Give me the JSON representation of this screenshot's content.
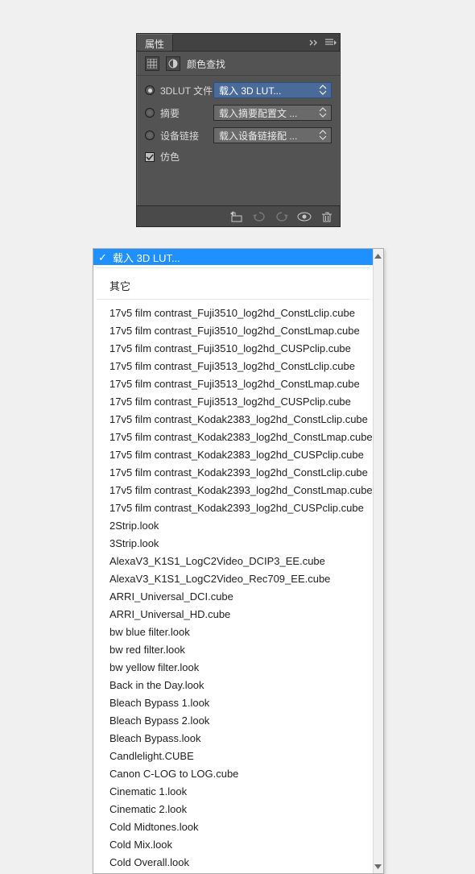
{
  "panel": {
    "tab_title": "属性",
    "header_title": "颜色查找",
    "rows": {
      "lut3d": {
        "label": "3DLUT 文件",
        "value": "载入 3D LUT..."
      },
      "abstract": {
        "label": "摘要",
        "value": "载入摘要配置文 ..."
      },
      "devicelink": {
        "label": "设备链接",
        "value": "载入设备链接配 ..."
      },
      "dither": {
        "label": "仿色"
      }
    }
  },
  "dropdown": {
    "selected": "载入 3D LUT...",
    "group_other": "其它",
    "items": [
      "17v5 film contrast_Fuji3510_log2hd_ConstLclip.cube",
      "17v5 film contrast_Fuji3510_log2hd_ConstLmap.cube",
      "17v5 film contrast_Fuji3510_log2hd_CUSPclip.cube",
      "17v5 film contrast_Fuji3513_log2hd_ConstLclip.cube",
      "17v5 film contrast_Fuji3513_log2hd_ConstLmap.cube",
      "17v5 film contrast_Fuji3513_log2hd_CUSPclip.cube",
      "17v5 film contrast_Kodak2383_log2hd_ConstLclip.cube",
      "17v5 film contrast_Kodak2383_log2hd_ConstLmap.cube",
      "17v5 film contrast_Kodak2383_log2hd_CUSPclip.cube",
      "17v5 film contrast_Kodak2393_log2hd_ConstLclip.cube",
      "17v5 film contrast_Kodak2393_log2hd_ConstLmap.cube",
      "17v5 film contrast_Kodak2393_log2hd_CUSPclip.cube",
      "2Strip.look",
      "3Strip.look",
      "AlexaV3_K1S1_LogC2Video_DCIP3_EE.cube",
      "AlexaV3_K1S1_LogC2Video_Rec709_EE.cube",
      "ARRI_Universal_DCI.cube",
      "ARRI_Universal_HD.cube",
      "bw blue filter.look",
      "bw red filter.look",
      "bw yellow filter.look",
      "Back in the Day.look",
      "Bleach Bypass 1.look",
      "Bleach Bypass 2.look",
      "Bleach Bypass.look",
      "Candlelight.CUBE",
      "Canon C-LOG to LOG.cube",
      "Cinematic 1.look",
      "Cinematic 2.look",
      "Cold Midtones.look",
      "Cold Mix.look",
      "Cold Overall.look"
    ]
  }
}
